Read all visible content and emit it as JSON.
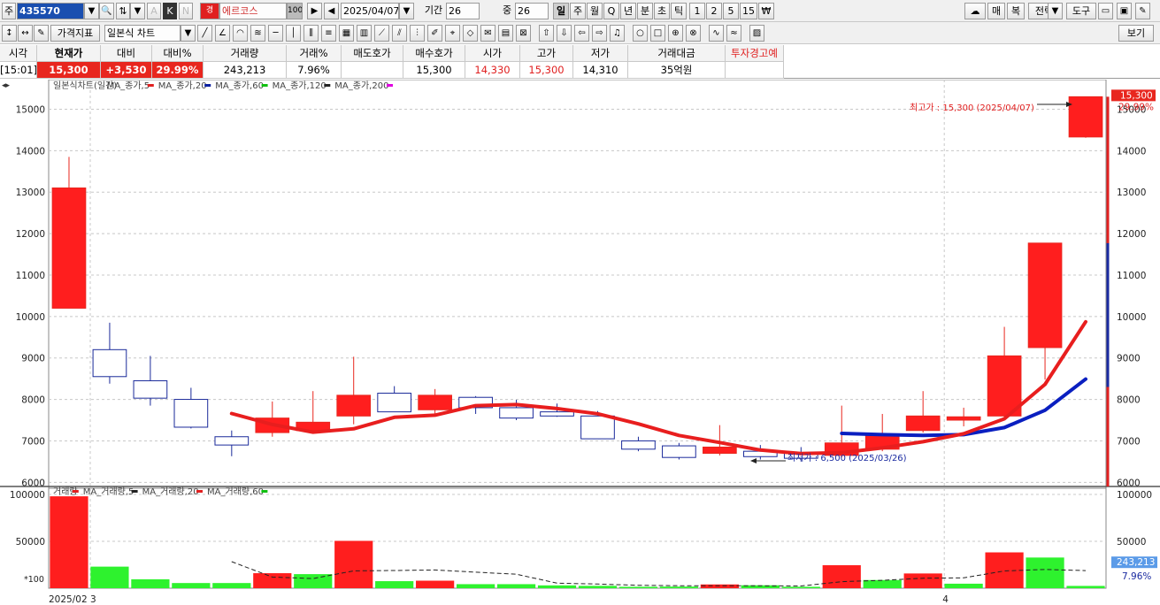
{
  "toolbar1": {
    "mode_label": "주",
    "code": "435570",
    "badge": "경",
    "stock_name": "에르코스",
    "name_pct": "100",
    "date": "2025/04/07",
    "period_label": "기간",
    "period_value": "26",
    "count_label": "중",
    "count_value": "26",
    "intervals": [
      "일",
      "주",
      "월",
      "Q",
      "년",
      "분",
      "초",
      "틱",
      "1",
      "2",
      "5",
      "15"
    ],
    "right_buttons": [
      "매",
      "복",
      "전략",
      "도구"
    ]
  },
  "toolbar2": {
    "price_indicator": "가격지표",
    "chart_type": "일본식 차트",
    "view_button": "보기"
  },
  "info": {
    "headers": [
      "시각",
      "현재가",
      "대비",
      "대비%",
      "거래량",
      "거래%",
      "매도호가",
      "매수호가",
      "시가",
      "고가",
      "저가",
      "거래대금",
      "투자경고예"
    ],
    "values": [
      "[15:01]",
      "15,300",
      "+3,530",
      "29.99%",
      "243,213",
      "7.96%",
      "",
      "15,300",
      "14,330",
      "15,300",
      "14,310",
      "35억원",
      ""
    ]
  },
  "legend": {
    "price": [
      {
        "label": "일본식차트(일간)",
        "color": "#444444"
      },
      {
        "label": "MA_종가,5",
        "color": "#e02020"
      },
      {
        "label": "MA_종가,20",
        "color": "#0a1fa0"
      },
      {
        "label": "MA_종가,60",
        "color": "#10c010"
      },
      {
        "label": "MA_종가,120",
        "color": "#222222"
      },
      {
        "label": "MA_종가,200",
        "color": "#e000e0"
      }
    ],
    "volume": [
      {
        "label": "거래량",
        "color": "#e02020"
      },
      {
        "label": "MA_거래량,5",
        "color": "#222222"
      },
      {
        "label": "MA_거래량,20",
        "color": "#e02020"
      },
      {
        "label": "MA_거래량,60",
        "color": "#10c010"
      }
    ]
  },
  "chart_data": {
    "type": "candlestick",
    "price_ylim": [
      5900,
      15500
    ],
    "price_ticks": [
      6000,
      7000,
      8000,
      9000,
      10000,
      11000,
      12000,
      13000,
      14000,
      15000
    ],
    "volume_ylim": [
      0,
      100000
    ],
    "volume_ticks": [
      50000,
      100000
    ],
    "volume_unit_label": "*100",
    "x_labels": [
      {
        "index": 0,
        "text": "2025/02 3"
      },
      {
        "index": 21,
        "text": "4"
      }
    ],
    "candles": [
      {
        "o": 10200,
        "h": 13850,
        "l": 10200,
        "c": 13100
      },
      {
        "o": 9200,
        "h": 9850,
        "l": 8380,
        "c": 8550
      },
      {
        "o": 8450,
        "h": 9050,
        "l": 7850,
        "c": 8030
      },
      {
        "o": 8000,
        "h": 8280,
        "l": 7300,
        "c": 7330
      },
      {
        "o": 7100,
        "h": 7250,
        "l": 6630,
        "c": 6900
      },
      {
        "o": 7200,
        "h": 7950,
        "l": 7100,
        "c": 7550
      },
      {
        "o": 7250,
        "h": 8200,
        "l": 7200,
        "c": 7450
      },
      {
        "o": 7600,
        "h": 9030,
        "l": 7400,
        "c": 8100
      },
      {
        "o": 8150,
        "h": 8320,
        "l": 7700,
        "c": 7700
      },
      {
        "o": 7750,
        "h": 8250,
        "l": 7650,
        "c": 8100
      },
      {
        "o": 8050,
        "h": 8080,
        "l": 7650,
        "c": 7800
      },
      {
        "o": 7800,
        "h": 7990,
        "l": 7500,
        "c": 7550
      },
      {
        "o": 7700,
        "h": 7900,
        "l": 7580,
        "c": 7600
      },
      {
        "o": 7600,
        "h": 7720,
        "l": 7050,
        "c": 7050
      },
      {
        "o": 7000,
        "h": 7100,
        "l": 6750,
        "c": 6800
      },
      {
        "o": 6880,
        "h": 6950,
        "l": 6550,
        "c": 6600
      },
      {
        "o": 6700,
        "h": 7380,
        "l": 6650,
        "c": 6850
      },
      {
        "o": 6750,
        "h": 6900,
        "l": 6550,
        "c": 6620
      },
      {
        "o": 6700,
        "h": 6850,
        "l": 6500,
        "c": 6580
      },
      {
        "o": 6650,
        "h": 7850,
        "l": 6600,
        "c": 6950
      },
      {
        "o": 6800,
        "h": 7650,
        "l": 6750,
        "c": 7150
      },
      {
        "o": 7250,
        "h": 8200,
        "l": 7200,
        "c": 7600
      },
      {
        "o": 7500,
        "h": 7800,
        "l": 7350,
        "c": 7580
      },
      {
        "o": 7600,
        "h": 9750,
        "l": 7550,
        "c": 9050
      },
      {
        "o": 9250,
        "h": 11770,
        "l": 8480,
        "c": 11770
      },
      {
        "o": 14330,
        "h": 15300,
        "l": 14310,
        "c": 15300
      }
    ],
    "ma5": [
      null,
      null,
      null,
      null,
      7660,
      7396,
      7210,
      7290,
      7568,
      7620,
      7850,
      7876,
      7780,
      7654,
      7410,
      7130,
      6960,
      6780,
      6694,
      6714,
      6830,
      6980,
      7172,
      7532,
      8364,
      9872
    ],
    "ma20": [
      null,
      null,
      null,
      null,
      null,
      null,
      null,
      null,
      null,
      null,
      null,
      null,
      null,
      null,
      null,
      null,
      null,
      null,
      null,
      7180,
      7150,
      7130,
      7150,
      7320,
      7740,
      8490
    ],
    "volume": [
      98000,
      23000,
      9500,
      5500,
      5500,
      16000,
      15000,
      50500,
      7500,
      8000,
      4300,
      4300,
      3000,
      2500,
      1500,
      1700,
      4000,
      3100,
      1500,
      24500,
      8700,
      15700,
      4800,
      38200,
      32700,
      2432
    ],
    "volume_colors": [
      "red",
      "green",
      "green",
      "green",
      "green",
      "red",
      "green",
      "red",
      "green",
      "red",
      "green",
      "green",
      "green",
      "green",
      "green",
      "green",
      "red",
      "green",
      "green",
      "red",
      "green",
      "red",
      "green",
      "red",
      "green",
      "green"
    ],
    "vma5": [
      null,
      null,
      null,
      null,
      28300,
      11900,
      10300,
      18500,
      18900,
      19400,
      17060,
      14920,
      5420,
      4420,
      3120,
      2660,
      2660,
      2560,
      2360,
      6960,
      8400,
      10700,
      11040,
      18380,
      20020,
      18766
    ],
    "annotations": {
      "max_label": "최고가 : 15,300 (2025/04/07)",
      "min_label": "최저가 : 6,500 (2025/03/26)",
      "current_price": "15,300",
      "current_pct": "29.99%",
      "current_volume": "243,213",
      "current_volume_pct": "7.96%"
    }
  }
}
